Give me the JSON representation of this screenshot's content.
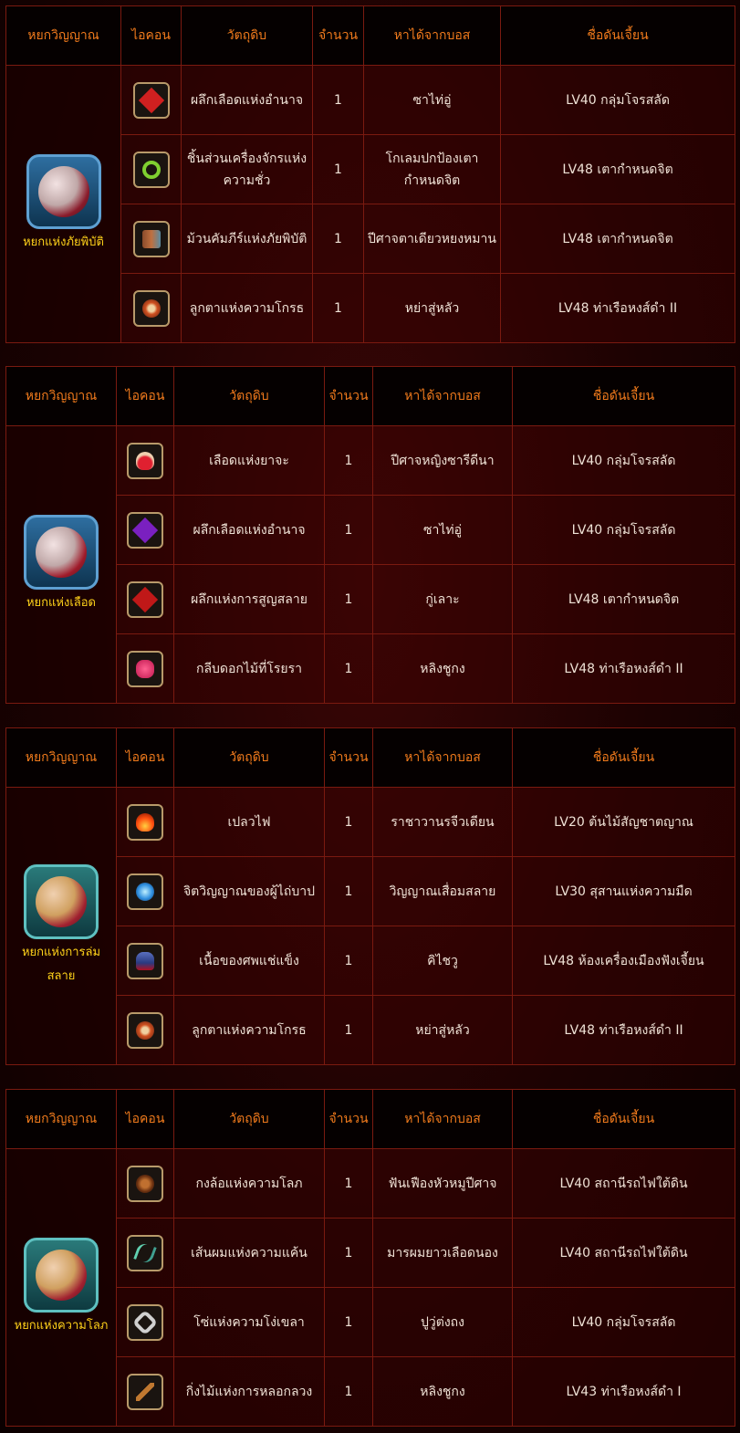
{
  "headers": {
    "spirit": "หยกวิญญาณ",
    "icon": "ไอคอน",
    "material": "วัตถุดิบ",
    "qty": "จำนวน",
    "boss": "หาได้จากบอส",
    "dungeon": "ชื่อดันเจี้ยน"
  },
  "tables": [
    {
      "spirit_name": "หยกแห่งภัยพิบัติ",
      "spirit_icon": "spirit-jade-icon",
      "rows": [
        {
          "icon": "red-crystal-icon",
          "material": "ผลึกเลือดแห่งอำนาจ",
          "qty": "1",
          "boss": "ซาไท่อู่",
          "dungeon": "LV40 กลุ่มโจรสลัด"
        },
        {
          "icon": "green-gear-icon",
          "material": "ชิ้นส่วนเครื่องจักรแห่งความชั่ว",
          "qty": "1",
          "boss": "โกเลมปกป้องเตากำหนดจิต",
          "dungeon": "LV48 เตากำหนดจิต"
        },
        {
          "icon": "scroll-icon",
          "material": "ม้วนคัมภีร์แห่งภัยพิบัติ",
          "qty": "1",
          "boss": "ปีศาจตาเดียวหยงหมาน",
          "dungeon": "LV48 เตากำหนดจิต"
        },
        {
          "icon": "eye-icon",
          "material": "ลูกตาแห่งความโกรธ",
          "qty": "1",
          "boss": "หย่าสู่หลัว",
          "dungeon": "LV48 ท่าเรือหงส์ดำ II"
        }
      ]
    },
    {
      "spirit_name": "หยกแห่งเลือด",
      "spirit_icon": "spirit-jade-icon",
      "rows": [
        {
          "icon": "potion-icon",
          "material": "เลือดแห่งยาจะ",
          "qty": "1",
          "boss": "ปีศาจหญิงซารีดีนา",
          "dungeon": "LV40 กลุ่มโจรสลัด"
        },
        {
          "icon": "purple-crystal-icon",
          "material": "ผลึกเลือดแห่งอำนาจ",
          "qty": "1",
          "boss": "ซาไท่อู่",
          "dungeon": "LV40 กลุ่มโจรสลัด"
        },
        {
          "icon": "red-crystal-icon",
          "material": "ผลึกแห่งการสูญสลาย",
          "qty": "1",
          "boss": "กู่เลาะ",
          "dungeon": "LV48 เตากำหนดจิต"
        },
        {
          "icon": "flower-icon",
          "material": "กลีบดอกไม้ที่โรยรา",
          "qty": "1",
          "boss": "หลิงชูกง",
          "dungeon": "LV48 ท่าเรือหงส์ดำ II"
        }
      ]
    },
    {
      "spirit_name": "หยกแห่งการล่มสลาย",
      "spirit_icon": "spirit-jade-icon",
      "rows": [
        {
          "icon": "flame-icon",
          "material": "เปลวไฟ",
          "qty": "1",
          "boss": "ราชาวานรจีวเดียน",
          "dungeon": "LV20 ต้นไม้สัญชาตญาณ"
        },
        {
          "icon": "soul-icon",
          "material": "จิตวิญญาณของผู้ไถ่บาป",
          "qty": "1",
          "boss": "วิญญาณเสื่อมสลาย",
          "dungeon": "LV30 สุสานแห่งความมืด"
        },
        {
          "icon": "frozen-flesh-icon",
          "material": "เนื้อของศพแช่แข็ง",
          "qty": "1",
          "boss": "คิไชวู",
          "dungeon": "LV48 ห้องเครื่องเมืองฟังเจี้ยน"
        },
        {
          "icon": "eye-icon",
          "material": "ลูกตาแห่งความโกรธ",
          "qty": "1",
          "boss": "หย่าสู่หลัว",
          "dungeon": "LV48 ท่าเรือหงส์ดำ II"
        }
      ]
    },
    {
      "spirit_name": "หยกแห่งความโลภ",
      "spirit_icon": "spirit-jade-icon",
      "rows": [
        {
          "icon": "wheel-icon",
          "material": "กงล้อแห่งความโลภ",
          "qty": "1",
          "boss": "ฟันเฟืองหัวหมูปีศาจ",
          "dungeon": "LV40 สถานีรถไฟใต้ดิน"
        },
        {
          "icon": "hair-icon",
          "material": "เส้นผมแห่งความแค้น",
          "qty": "1",
          "boss": "มารผมยาวเลือดนอง",
          "dungeon": "LV40 สถานีรถไฟใต้ดิน"
        },
        {
          "icon": "chain-icon",
          "material": "โซ่แห่งความโง่เขลา",
          "qty": "1",
          "boss": "ปูวู่ต่งถง",
          "dungeon": "LV40 กลุ่มโจรสลัด"
        },
        {
          "icon": "branch-icon",
          "material": "กิ่งไม้แห่งการหลอกลวง",
          "qty": "1",
          "boss": "หลิงชูกง",
          "dungeon": "LV43 ท่าเรือหงส์ดำ I"
        }
      ]
    }
  ]
}
